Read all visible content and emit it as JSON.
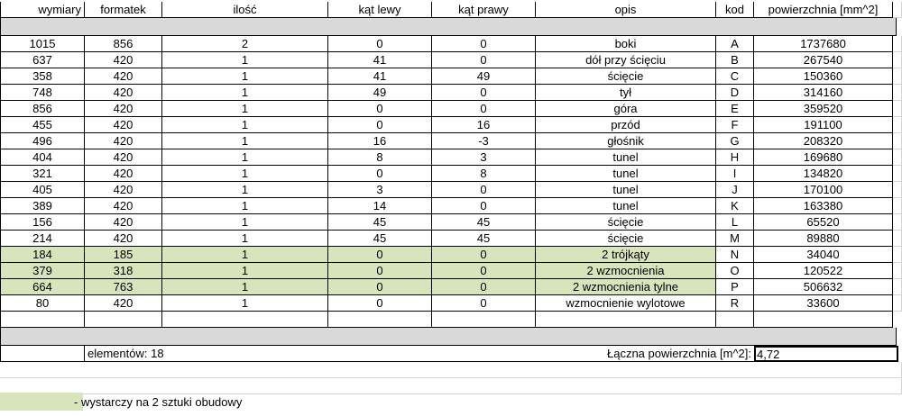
{
  "headers": [
    "wymiary",
    "formatek",
    "ilość",
    "kąt lewy",
    "kąt prawy",
    "opis",
    "kod",
    "powierzchnia [mm^2]"
  ],
  "rows": [
    {
      "wymiary": "1015",
      "formatek": "856",
      "ilosc": "2",
      "kat_lewy": "0",
      "kat_prawy": "0",
      "opis": "boki",
      "kod": "A",
      "powierzchnia": "1737680",
      "highlight": false
    },
    {
      "wymiary": "637",
      "formatek": "420",
      "ilosc": "1",
      "kat_lewy": "41",
      "kat_prawy": "0",
      "opis": "dół przy ścięciu",
      "kod": "B",
      "powierzchnia": "267540",
      "highlight": false
    },
    {
      "wymiary": "358",
      "formatek": "420",
      "ilosc": "1",
      "kat_lewy": "41",
      "kat_prawy": "49",
      "opis": "ścięcie",
      "kod": "C",
      "powierzchnia": "150360",
      "highlight": false
    },
    {
      "wymiary": "748",
      "formatek": "420",
      "ilosc": "1",
      "kat_lewy": "49",
      "kat_prawy": "0",
      "opis": "tył",
      "kod": "D",
      "powierzchnia": "314160",
      "highlight": false
    },
    {
      "wymiary": "856",
      "formatek": "420",
      "ilosc": "1",
      "kat_lewy": "0",
      "kat_prawy": "0",
      "opis": "góra",
      "kod": "E",
      "powierzchnia": "359520",
      "highlight": false
    },
    {
      "wymiary": "455",
      "formatek": "420",
      "ilosc": "1",
      "kat_lewy": "0",
      "kat_prawy": "16",
      "opis": "przód",
      "kod": "F",
      "powierzchnia": "191100",
      "highlight": false
    },
    {
      "wymiary": "496",
      "formatek": "420",
      "ilosc": "1",
      "kat_lewy": "16",
      "kat_prawy": "-3",
      "opis": "głośnik",
      "kod": "G",
      "powierzchnia": "208320",
      "highlight": false
    },
    {
      "wymiary": "404",
      "formatek": "420",
      "ilosc": "1",
      "kat_lewy": "8",
      "kat_prawy": "3",
      "opis": "tunel",
      "kod": "H",
      "powierzchnia": "169680",
      "highlight": false
    },
    {
      "wymiary": "321",
      "formatek": "420",
      "ilosc": "1",
      "kat_lewy": "0",
      "kat_prawy": "8",
      "opis": "tunel",
      "kod": "I",
      "powierzchnia": "134820",
      "highlight": false
    },
    {
      "wymiary": "405",
      "formatek": "420",
      "ilosc": "1",
      "kat_lewy": "3",
      "kat_prawy": "0",
      "opis": "tunel",
      "kod": "J",
      "powierzchnia": "170100",
      "highlight": false
    },
    {
      "wymiary": "389",
      "formatek": "420",
      "ilosc": "1",
      "kat_lewy": "14",
      "kat_prawy": "0",
      "opis": "tunel",
      "kod": "K",
      "powierzchnia": "163380",
      "highlight": false
    },
    {
      "wymiary": "156",
      "formatek": "420",
      "ilosc": "1",
      "kat_lewy": "45",
      "kat_prawy": "45",
      "opis": "ścięcie",
      "kod": "L",
      "powierzchnia": "65520",
      "highlight": false
    },
    {
      "wymiary": "214",
      "formatek": "420",
      "ilosc": "1",
      "kat_lewy": "45",
      "kat_prawy": "45",
      "opis": "ścięcie",
      "kod": "M",
      "powierzchnia": "89880",
      "highlight": false
    },
    {
      "wymiary": "184",
      "formatek": "185",
      "ilosc": "1",
      "kat_lewy": "0",
      "kat_prawy": "0",
      "opis": "2 trójkąty",
      "kod": "N",
      "powierzchnia": "34040",
      "highlight": true
    },
    {
      "wymiary": "379",
      "formatek": "318",
      "ilosc": "1",
      "kat_lewy": "0",
      "kat_prawy": "0",
      "opis": "2 wzmocnienia",
      "kod": "O",
      "powierzchnia": "120522",
      "highlight": true
    },
    {
      "wymiary": "664",
      "formatek": "763",
      "ilosc": "1",
      "kat_lewy": "0",
      "kat_prawy": "0",
      "opis": "2 wzmocnienia tylne",
      "kod": "P",
      "powierzchnia": "506632",
      "highlight": true
    },
    {
      "wymiary": "80",
      "formatek": "420",
      "ilosc": "1",
      "kat_lewy": "0",
      "kat_prawy": "0",
      "opis": "wzmocnienie wylotowe",
      "kod": "R",
      "powierzchnia": "33600",
      "highlight": false
    }
  ],
  "summary": {
    "elements_label": "elementów: 18",
    "total_label": "Łączna powierzchnia [m^2]:",
    "total_value": "4,72"
  },
  "legend": {
    "text": "- wystarczy na 2 sztuki obudowy"
  },
  "colors": {
    "highlight": "#d8e4bc",
    "band": "#d9d9d9"
  }
}
